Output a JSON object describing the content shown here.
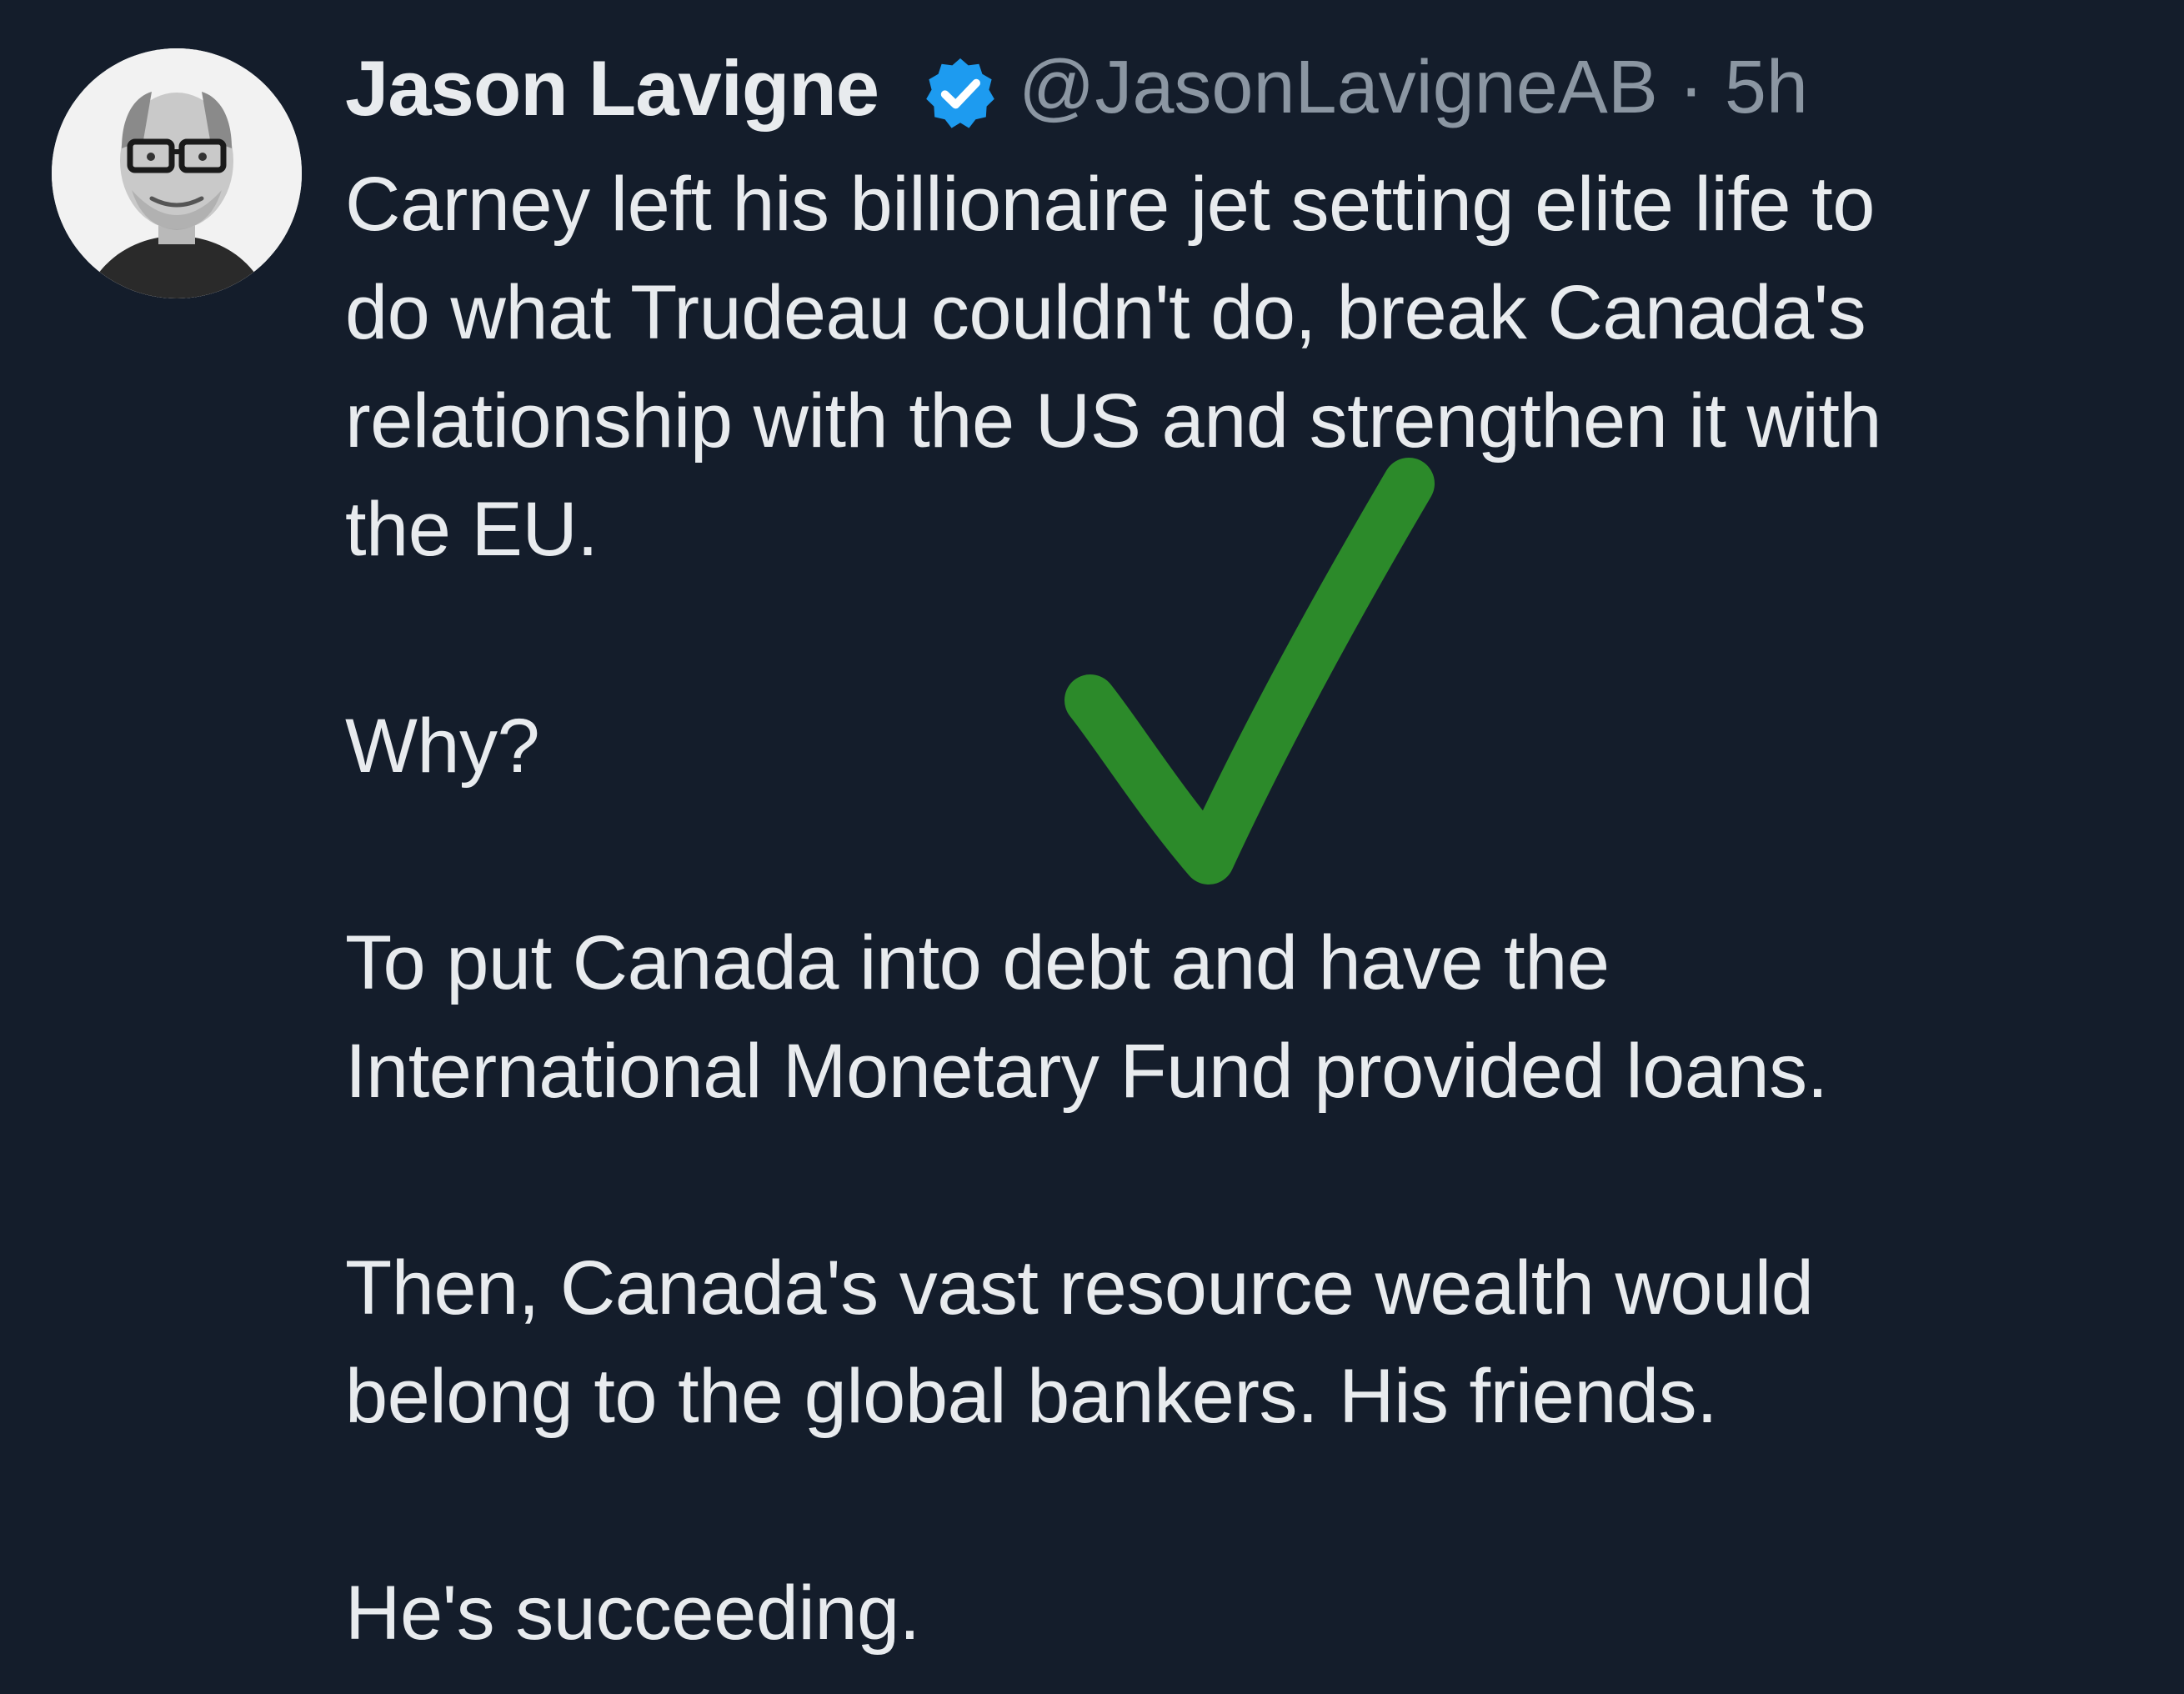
{
  "author": {
    "display_name": "Jason Lavigne",
    "handle": "@JasonLavigneAB",
    "separator": "·",
    "time": "5h",
    "verified": true,
    "verified_color": "#1d9bf0"
  },
  "icons": {
    "avatar": "profile-photo",
    "verified": "verified-badge-icon",
    "grok": "grok-icon",
    "more": "more-options-icon",
    "overlay": "green-checkmark-icon"
  },
  "tweet": {
    "paragraphs": [
      "Carney left his billionaire jet setting elite life to\ndo what Trudeau couldn't do, break Canada's\nrelationship with the US and strengthen it with\nthe EU.",
      "Why?",
      "To put Canada into debt and have the\nInternational Monetary Fund provided loans.",
      "Then, Canada's vast resource wealth would\nbelong to the global bankers. His friends.",
      "He's succeeding."
    ]
  },
  "colors": {
    "background": "#141d2b",
    "text": "#e8ebee",
    "muted": "#8b96a2",
    "checkmark": "#2c8a2a"
  }
}
